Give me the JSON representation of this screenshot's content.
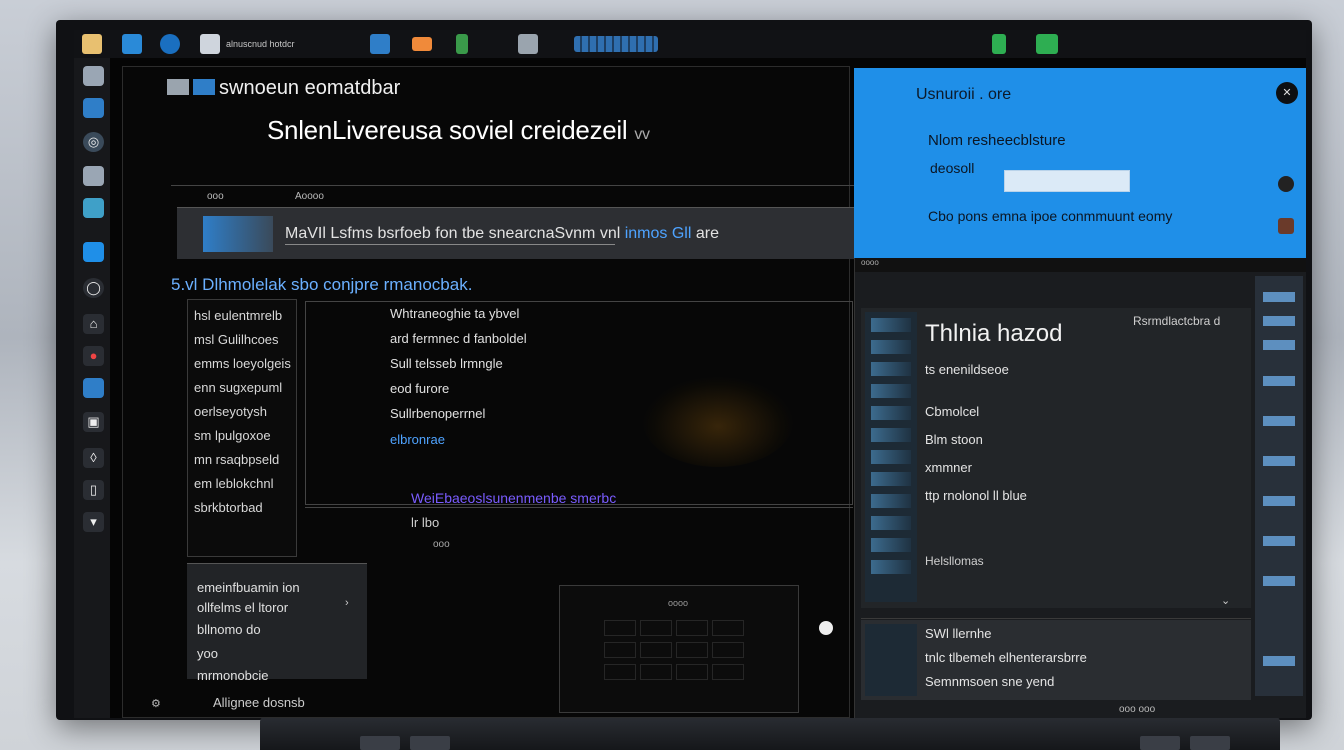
{
  "taskbar": {
    "app_label": "alnuscnud hotdcr",
    "icons": [
      "folder-icon",
      "chrome-icon",
      "terminal-icon",
      "files-icon",
      "mail-icon",
      "settings-icon",
      "network-icon",
      "battery-icon"
    ]
  },
  "dock": {
    "items": [
      "files-icon",
      "monitor-icon",
      "safari-icon",
      "drive-icon",
      "display-icon",
      "photos-icon",
      "circle-icon",
      "user-icon",
      "git-icon",
      "app-icon",
      "box-icon",
      "lock-icon",
      "phone-icon",
      "shield-icon"
    ]
  },
  "window": {
    "title": "swnoeun eomatdbar",
    "headline": "SnlenLivereusa soviel creidezeil",
    "headline_suffix": "vv",
    "col_headers": [
      "ooo",
      "Aoooo"
    ]
  },
  "infobar": {
    "text": "MaVIl Lsfms bsrfoeb fon tbe snearcnaSvnm vnl",
    "link": "inmos Gll",
    "suffix": "are"
  },
  "subtitle": "5.vl Dlhmolelak sbo conjpre rmanocbak.",
  "left_list": [
    "hsl eulentmrelb",
    "msl Gulilhcoes",
    "emms loeyolgeis",
    "enn sugxepuml",
    "oerlseyotysh",
    "sm lpulgoxoe",
    "mn rsaqbpseld",
    "em leblokchnl",
    "sbrkbtorbad"
  ],
  "options": {
    "items": [
      "Whtraneoghie ta ybvel",
      "ard fermnec d fanboldel",
      "Sull telsseb lrmngle",
      "eod furore",
      "Sullrbenoperrnel",
      "elbronrae"
    ],
    "purple_line": "WeiEbaeoslsunenmenbe smerbc",
    "footer": "lr lbo",
    "ok_label": "ooo"
  },
  "lower_panel": {
    "items": [
      "emeinfbuamin ion",
      "ollfelms el ltoror",
      "bllnomo do",
      "yoo",
      "mrmonobcie"
    ]
  },
  "dark_box_label": "oooo",
  "bottom_text": "Allignee dosnsb",
  "blue_dialog": {
    "title": "Usnuroii .  ore",
    "line1": "Nlom resheecblsture",
    "label": "deosoll",
    "input_value": "",
    "footer": "Cbo pons emna ipoe conmmuunt eomy",
    "accent": "#1f8fe8"
  },
  "right_panel": {
    "top_label": "oooo",
    "title": "Thlnia hazod",
    "right_label": "Rsrmdlactcbra d",
    "items": [
      "ts enenildseoe",
      "Cbmolcel",
      "Blm stoon",
      "xmmner",
      "ttp rnolonol ll blue"
    ],
    "footer": "Helsllomas",
    "bottom_items": [
      "SWl llernhe",
      "tnlc tlbemeh elhenterarsbrre",
      "Semnmsoen sne yend"
    ],
    "status": "ooo ooo"
  }
}
